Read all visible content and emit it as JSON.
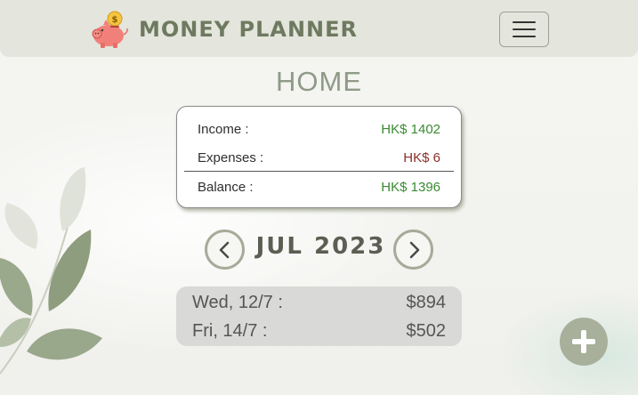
{
  "navbar": {
    "brand": "MONEY PLANNER",
    "logo_icon": "piggy-bank-coin-icon",
    "menu_icon": "hamburger-menu-icon"
  },
  "page": {
    "title": "HOME"
  },
  "summary": {
    "income_label": "Income :",
    "income_value": "HK$ 1402",
    "expenses_label": "Expenses :",
    "expenses_value": "HK$ 6",
    "balance_label": "Balance :",
    "balance_value": "HK$ 1396"
  },
  "month_nav": {
    "month": "JUL",
    "year": "2023",
    "prev_icon": "chevron-left-icon",
    "next_icon": "chevron-right-icon"
  },
  "entries": [
    {
      "date": "Wed, 12/7 :",
      "amount": "$894"
    },
    {
      "date": "Fri, 14/7 :",
      "amount": "$502"
    }
  ],
  "fab": {
    "icon": "plus-icon"
  },
  "colors": {
    "accent": "#8f9a87",
    "income": "#3a8a32",
    "expense": "#8a2f2a",
    "navbar_bg": "#e4e5dc"
  }
}
